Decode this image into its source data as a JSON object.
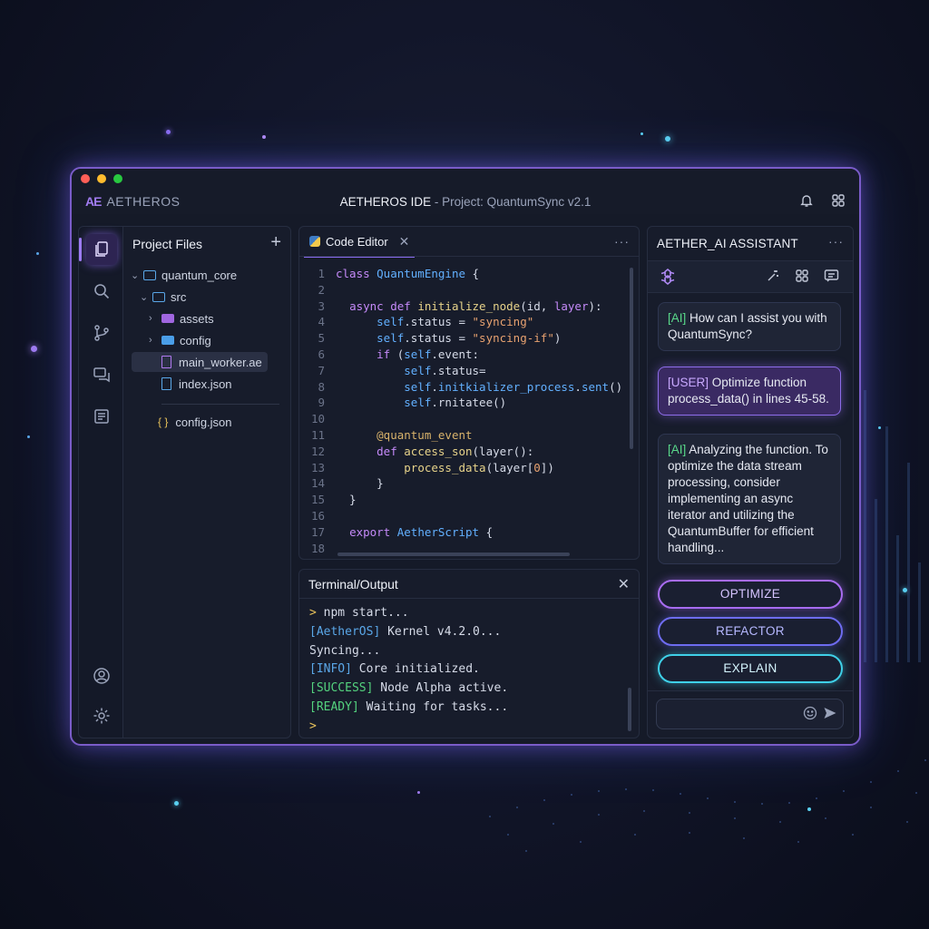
{
  "window": {
    "brand": "AETHEROS",
    "brand_logo": "AE",
    "title_main": "AETHEROS IDE",
    "title_sub": "- Project: QuantumSync v2.1",
    "traffic_colors": [
      "#ff5f57",
      "#febc2e",
      "#28c840"
    ]
  },
  "explorer": {
    "title": "Project Files",
    "items": [
      {
        "label": "quantum_core",
        "type": "folder-open"
      },
      {
        "label": "src",
        "type": "folder-open"
      },
      {
        "label": "assets",
        "type": "folder"
      },
      {
        "label": "config",
        "type": "folder"
      },
      {
        "label": "main_worker.ae",
        "type": "file",
        "selected": true
      },
      {
        "label": "index.json",
        "type": "file"
      },
      {
        "label": "config.json",
        "type": "json",
        "icon_text": "{ }"
      }
    ]
  },
  "editor": {
    "tab_label": "Code Editor",
    "lines": [
      {
        "n": "1",
        "segs": [
          [
            "kw",
            "class "
          ],
          [
            "cls",
            "QuantumEngine"
          ],
          [
            "pl",
            " {"
          ]
        ]
      },
      {
        "n": "2",
        "segs": []
      },
      {
        "n": "3",
        "segs": [
          [
            "pl",
            "  "
          ],
          [
            "kw",
            "async def "
          ],
          [
            "fn",
            "initialize_node"
          ],
          [
            "pl",
            "(id, "
          ],
          [
            "kw",
            "layer"
          ],
          [
            "pl",
            "):"
          ]
        ]
      },
      {
        "n": "4",
        "segs": [
          [
            "pl",
            "      "
          ],
          [
            "cls",
            "self"
          ],
          [
            "pl",
            ".status = "
          ],
          [
            "str",
            "\"syncing\""
          ]
        ]
      },
      {
        "n": "5",
        "segs": [
          [
            "pl",
            "      "
          ],
          [
            "cls",
            "self"
          ],
          [
            "pl",
            ".status = "
          ],
          [
            "str",
            "\"syncing-if\""
          ],
          [
            "pl",
            ")"
          ]
        ]
      },
      {
        "n": "6",
        "segs": [
          [
            "pl",
            "      "
          ],
          [
            "kw",
            "if "
          ],
          [
            "pl",
            "("
          ],
          [
            "cls",
            "self"
          ],
          [
            "pl",
            ".event:"
          ]
        ]
      },
      {
        "n": "7",
        "segs": [
          [
            "pl",
            "          "
          ],
          [
            "cls",
            "self"
          ],
          [
            "pl",
            ".status="
          ]
        ]
      },
      {
        "n": "8",
        "segs": [
          [
            "pl",
            "          "
          ],
          [
            "cls",
            "self"
          ],
          [
            "pl",
            "."
          ],
          [
            "cls",
            "initkializer_process"
          ],
          [
            "pl",
            "."
          ],
          [
            "cls",
            "sent"
          ],
          [
            "pl",
            "()"
          ]
        ]
      },
      {
        "n": "9",
        "segs": [
          [
            "pl",
            "          "
          ],
          [
            "cls",
            "self"
          ],
          [
            "pl",
            ".rnitatee()"
          ]
        ]
      },
      {
        "n": "10",
        "segs": []
      },
      {
        "n": "11",
        "segs": [
          [
            "pl",
            "      "
          ],
          [
            "dec",
            "@quantum_event"
          ]
        ]
      },
      {
        "n": "12",
        "segs": [
          [
            "pl",
            "      "
          ],
          [
            "kw",
            "def "
          ],
          [
            "fn",
            "access_son"
          ],
          [
            "pl",
            "(layer():"
          ]
        ]
      },
      {
        "n": "13",
        "segs": [
          [
            "pl",
            "          "
          ],
          [
            "fn",
            "process_data"
          ],
          [
            "pl",
            "(layer["
          ],
          [
            "str",
            "0"
          ],
          [
            "pl",
            "])"
          ]
        ]
      },
      {
        "n": "14",
        "segs": [
          [
            "pl",
            "      }"
          ]
        ]
      },
      {
        "n": "15",
        "segs": [
          [
            "pl",
            "  }"
          ]
        ]
      },
      {
        "n": "16",
        "segs": []
      },
      {
        "n": "17",
        "segs": [
          [
            "pl",
            "  "
          ],
          [
            "kw",
            "export "
          ],
          [
            "cls",
            "AetherScript"
          ],
          [
            "pl",
            " {"
          ]
        ]
      },
      {
        "n": "18",
        "segs": []
      }
    ]
  },
  "terminal": {
    "title": "Terminal/Output",
    "lines": [
      {
        "tag": ">",
        "tag_class": "t-prompt",
        "text": " npm start..."
      },
      {
        "tag": "[AetherOS]",
        "tag_class": "t-blue",
        "text": " Kernel v4.2.0..."
      },
      {
        "tag": "",
        "tag_class": "",
        "text": "Syncing..."
      },
      {
        "tag": "[INFO]",
        "tag_class": "t-blue",
        "text": " Core initialized."
      },
      {
        "tag": "[SUCCESS]",
        "tag_class": "t-green",
        "text": " Node Alpha active."
      },
      {
        "tag": "[READY]",
        "tag_class": "t-green",
        "text": " Waiting for tasks..."
      },
      {
        "tag": ">",
        "tag_class": "t-prompt",
        "text": ""
      }
    ]
  },
  "assistant": {
    "title": "AETHER_AI ASSISTANT",
    "messages": [
      {
        "role": "ai",
        "tag": "[AI]",
        "text": " How can I assist you with QuantumSync?"
      },
      {
        "role": "user",
        "tag": "[USER]",
        "text": " Optimize function process_data() in lines 45-58."
      },
      {
        "role": "ai",
        "tag": "[AI]",
        "text": " Analyzing the function. To optimize the data stream processing, consider implementing an async iterator and utilizing the QuantumBuffer for efficient handling..."
      }
    ],
    "actions": {
      "optimize": "OPTIMIZE",
      "refactor": "REFACTOR",
      "explain": "EXPLAIN"
    },
    "input_placeholder": ""
  },
  "colors": {
    "accent": "#8a6cf0",
    "cyan": "#3fd0e8",
    "background": "#12162a"
  }
}
